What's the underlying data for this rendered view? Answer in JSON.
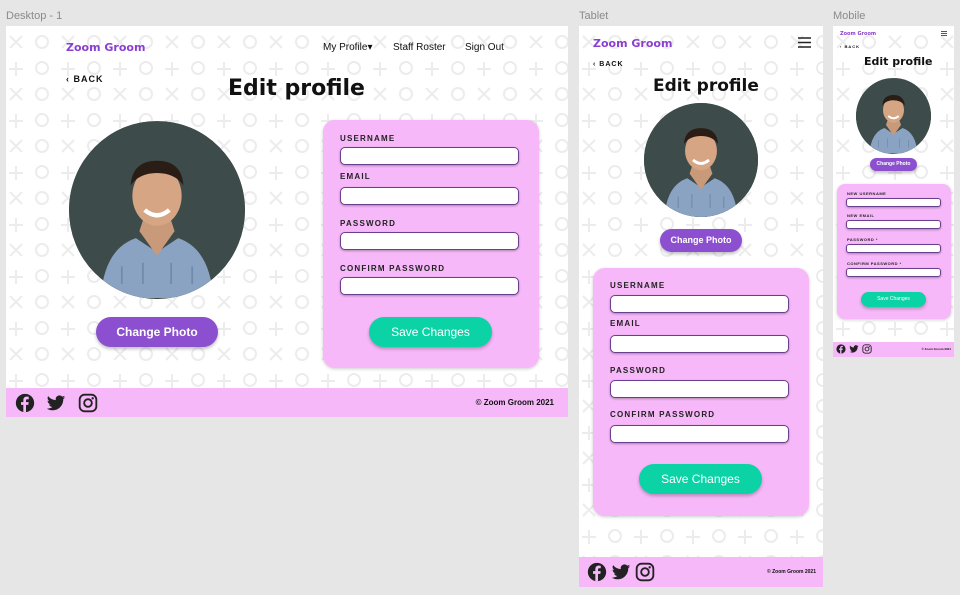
{
  "frames": {
    "desktop_label": "Desktop - 1",
    "tablet_label": "Tablet",
    "mobile_label": "Mobile"
  },
  "brand": "Zoom Groom",
  "nav": {
    "my_profile": "My Profile▾",
    "staff_roster": "Staff Roster",
    "sign_out": "Sign Out"
  },
  "back": "‹ BACK",
  "title": "Edit profile",
  "change_photo": "Change Photo",
  "save_changes": "Save Changes",
  "fields": {
    "username": "USERNAME",
    "email": "EMAIL",
    "password": "PASSWORD",
    "confirm_password": "CONFIRM PASSWORD"
  },
  "mobile_fields": {
    "username": "NEW USERNAME",
    "email": "NEW EMAIL",
    "password": "PASSWORD *",
    "confirm_password": "CONFIRM PASSWORD *"
  },
  "copyright": "© Zoom Groom 2021",
  "icons": [
    "facebook-icon",
    "twitter-icon",
    "instagram-icon",
    "hamburger-menu-icon"
  ],
  "colors": {
    "brand_purple": "#8a3fd1",
    "button_purple": "#8b4fcf",
    "card_pink": "#f7b8f9",
    "teal": "#0bd3a6"
  }
}
